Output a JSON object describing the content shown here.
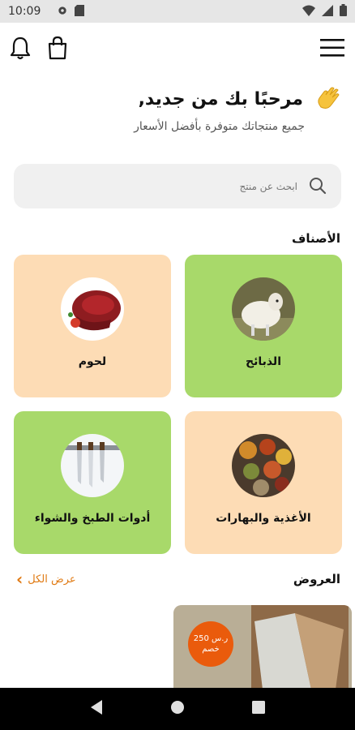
{
  "status_bar": {
    "time": "10:09"
  },
  "header": {
    "menu_icon": "hamburger-icon",
    "bell_icon": "bell-icon",
    "bag_icon": "shopping-bag-icon"
  },
  "greeting": {
    "title": "مرحبًا بك من جديد,",
    "subtitle": "جميع منتجاتك متوفرة بأفضل الأسعار"
  },
  "search": {
    "placeholder": "ابحث عن منتج"
  },
  "categories": {
    "title": "الأصناف",
    "items": [
      {
        "label": "الذبائح"
      },
      {
        "label": "لحوم"
      },
      {
        "label": "الأغذية والبهارات"
      },
      {
        "label": "أدوات الطبخ والشواء"
      }
    ]
  },
  "offers": {
    "title": "العروض",
    "view_all": "عرض الكل",
    "items": [
      {
        "price": "250 ر.س",
        "discount": "خصم"
      }
    ]
  },
  "colors": {
    "green_card": "#a8d96a",
    "peach_card": "#fddcb5",
    "accent": "#e07a13",
    "badge": "#ea5b0c"
  }
}
